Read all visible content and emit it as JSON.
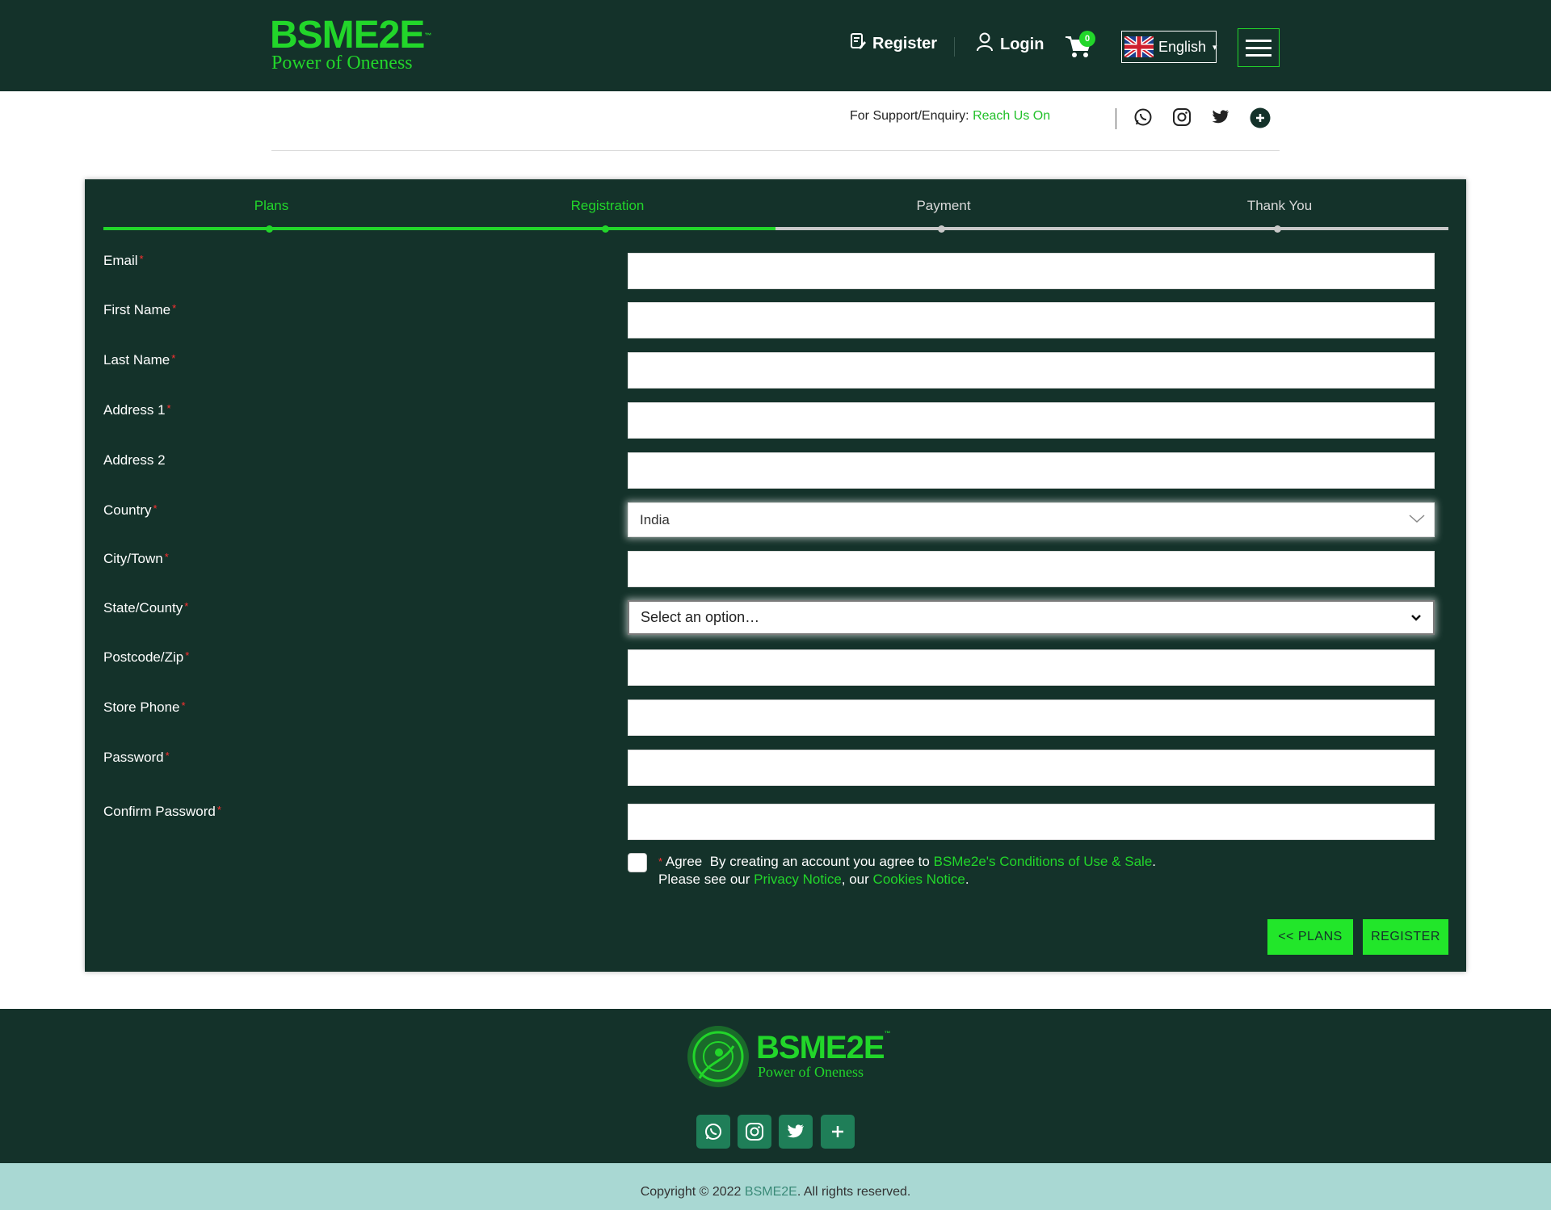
{
  "header": {
    "logo_brand": "BSME2E",
    "logo_tm": "™",
    "logo_tagline": "Power of Oneness",
    "register_label": "Register",
    "login_label": "Login",
    "cart_count": "0",
    "language": "English",
    "language_caret": "▾"
  },
  "support": {
    "label": "For Support/Enquiry:",
    "link": "Reach Us On"
  },
  "steps": [
    {
      "label": "Plans",
      "state": "done"
    },
    {
      "label": "Registration",
      "state": "done"
    },
    {
      "label": "Payment",
      "state": "todo"
    },
    {
      "label": "Thank You",
      "state": "todo"
    }
  ],
  "form": {
    "required_mark": "*",
    "email_label": "Email",
    "first_name_label": "First Name",
    "last_name_label": "Last Name",
    "address1_label": "Address 1",
    "address2_label": "Address 2",
    "country_label": "Country",
    "country_value": "India",
    "city_label": "City/Town",
    "state_label": "State/County",
    "state_value": "Select an option…",
    "postcode_label": "Postcode/Zip",
    "phone_label": "Store Phone",
    "password_label": "Password",
    "confirm_password_label": "Confirm Password",
    "agree_label": "Agree",
    "agree_text_1": "By creating an account you agree to",
    "conditions_link": "BSMe2e's Conditions of Use & Sale",
    "agree_text_2": "Please see our",
    "privacy_link": "Privacy Notice",
    "agree_text_3": ", our",
    "cookies_link": "Cookies Notice",
    "plans_button": "<< PLANS",
    "register_button": "REGISTER"
  },
  "footer": {
    "logo_brand": "BSME2E",
    "logo_tm": "™",
    "logo_tagline": "Power of Oneness",
    "copyright": "Copyright © 2022",
    "copyright_brand": "BSME2E",
    "copyright_rest": ". All rights reserved."
  },
  "colors": {
    "dark_green": "#14322a",
    "accent_green": "#22d62a",
    "footer_icon_bg": "#1f7e58",
    "copyright_bar": "#a9d8d3",
    "required_red": "#ff3030"
  },
  "icons": [
    "register-icon",
    "user-icon",
    "cart-icon",
    "uk-flag-icon",
    "menu-icon",
    "whatsapp-icon",
    "instagram-icon",
    "twitter-icon",
    "plus-icon",
    "chevron-down-icon"
  ]
}
